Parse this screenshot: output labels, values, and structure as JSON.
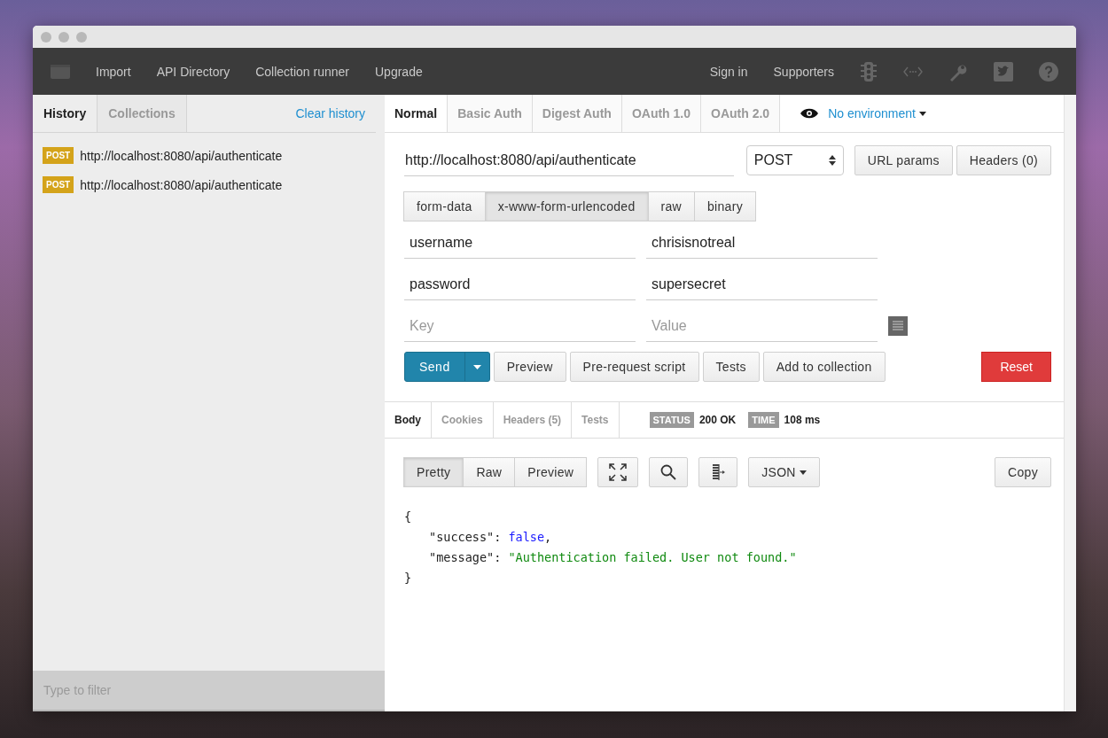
{
  "menubar": {
    "items": [
      "Import",
      "API Directory",
      "Collection runner",
      "Upgrade"
    ],
    "right_items": [
      "Sign in",
      "Supporters"
    ]
  },
  "sidebar": {
    "tabs": [
      {
        "label": "History",
        "selected": true
      },
      {
        "label": "Collections",
        "selected": false
      }
    ],
    "clear_history": "Clear history",
    "history": [
      {
        "method": "POST",
        "url": "http://localhost:8080/api/authenticate"
      },
      {
        "method": "POST",
        "url": "http://localhost:8080/api/authenticate"
      }
    ],
    "filter": {
      "placeholder": "Type to filter"
    }
  },
  "auth_tabs": [
    {
      "label": "Normal",
      "selected": true
    },
    {
      "label": "Basic Auth",
      "selected": false
    },
    {
      "label": "Digest Auth",
      "selected": false
    },
    {
      "label": "OAuth 1.0",
      "selected": false
    },
    {
      "label": "OAuth 2.0",
      "selected": false
    }
  ],
  "environment": "No environment",
  "request": {
    "url": "http://localhost:8080/api/authenticate",
    "method": "POST",
    "buttons": [
      "URL params",
      "Headers (0)"
    ]
  },
  "body_tabs": [
    {
      "label": "form-data",
      "selected": false
    },
    {
      "label": "x-www-form-urlencoded",
      "selected": true
    },
    {
      "label": "raw",
      "selected": false
    },
    {
      "label": "binary",
      "selected": false
    }
  ],
  "params": [
    {
      "key": "username",
      "value": "chrisisnotreal"
    },
    {
      "key": "password",
      "value": "supersecret"
    }
  ],
  "new_param": {
    "key_placeholder": "Key",
    "value_placeholder": "Value"
  },
  "actions": {
    "send": "Send",
    "buttons": [
      "Preview",
      "Pre-request script",
      "Tests",
      "Add to collection"
    ],
    "reset": "Reset"
  },
  "response": {
    "tabs": [
      {
        "label": "Body",
        "selected": true
      },
      {
        "label": "Cookies",
        "selected": false
      },
      {
        "label": "Headers (5)",
        "selected": false
      },
      {
        "label": "Tests",
        "selected": false
      }
    ],
    "status_label": "STATUS",
    "status": "200 OK",
    "time_label": "TIME",
    "time": "108 ms",
    "view_modes": [
      {
        "label": "Pretty",
        "selected": true
      },
      {
        "label": "Raw",
        "selected": false
      },
      {
        "label": "Preview",
        "selected": false
      }
    ],
    "format": "JSON",
    "copy": "Copy",
    "body": {
      "open": "{",
      "close": "}",
      "members": [
        {
          "tokens": [
            {
              "kind": "key",
              "text": "\"success\""
            },
            {
              "kind": "punct",
              "text": ": "
            },
            {
              "kind": "boolean",
              "text": "false"
            },
            {
              "kind": "punct",
              "text": ","
            }
          ]
        },
        {
          "tokens": [
            {
              "kind": "key",
              "text": "\"message\""
            },
            {
              "kind": "punct",
              "text": ": "
            },
            {
              "kind": "string",
              "text": "\"Authentication failed. User not found.\""
            }
          ]
        }
      ]
    }
  }
}
